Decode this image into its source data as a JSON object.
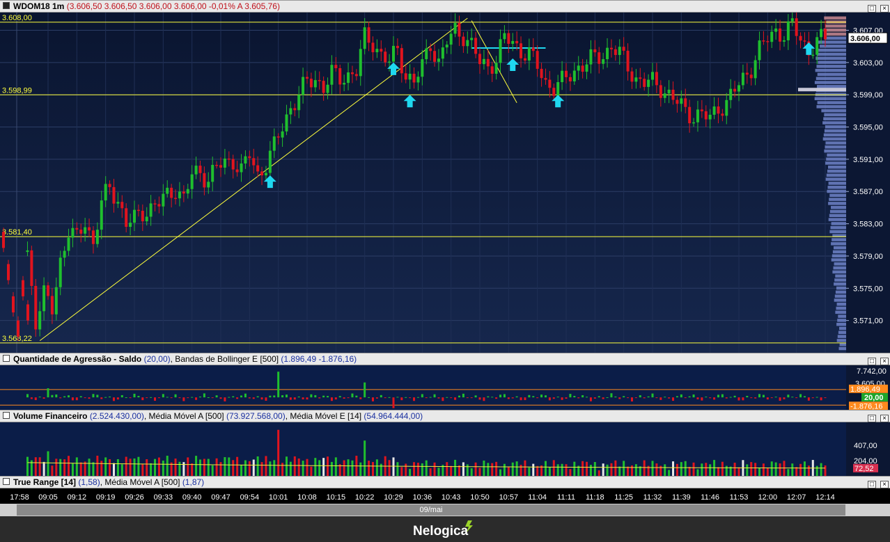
{
  "main": {
    "title": "WDOM18 1m",
    "ohlc": "(3.606,50  3.606,50  3.606,00  3.606,00  -0,01%  A 3.605,76)",
    "last_price_label": "3.606,00",
    "level_labels": [
      "3.608,00",
      "3.598,99",
      "3.581,40",
      "3.568,22"
    ],
    "colors": {
      "up": "#1fbf2e",
      "down": "#e0141e",
      "level": "#ffff3c",
      "arrow": "#1fd8f0",
      "profile": "#6f82c8",
      "profile_top": "#c98890"
    }
  },
  "agr": {
    "title": "Quantidade de Agressão - Saldo",
    "value": "(20,00)",
    "bb_label": ", Bandas de Bollinger E [500]",
    "bb_values": "(1.896,49  -1.876,16)",
    "axis": {
      "top": "7.742,00",
      "mid": "3.605,00",
      "upper": "1.896,49",
      "current": "20,00",
      "lower": "-1.876,16"
    }
  },
  "vol": {
    "title": "Volume Financeiro",
    "value": "(2.524.430,00)",
    "ma_a_label": ", Média Móvel A [500]",
    "ma_a_value": "(73.927.568,00)",
    "ma_e_label": ", Média Móvel E [14]",
    "ma_e_value": "(54.964.444,00)",
    "axis": {
      "top": "407,00",
      "mid": "204,00",
      "current": "72,52"
    }
  },
  "tr": {
    "title": "True Range [14]",
    "value": "(1,58)",
    "ma_label": ", Média Móvel A [500]",
    "ma_value": "(1,87)"
  },
  "date_label": "09/mai",
  "brand": "Nelogica",
  "chart_data": {
    "type": "candlestick",
    "title": "WDOM18 1m",
    "x_ticks": [
      "17:58",
      "09:05",
      "09:12",
      "09:19",
      "09:26",
      "09:33",
      "09:40",
      "09:47",
      "09:54",
      "10:01",
      "10:08",
      "10:15",
      "10:22",
      "10:29",
      "10:36",
      "10:43",
      "10:50",
      "10:57",
      "11:04",
      "11:11",
      "11:18",
      "11:25",
      "11:32",
      "11:39",
      "11:46",
      "11:53",
      "12:00",
      "12:07",
      "12:14"
    ],
    "y_ticks": [
      "3.607,00",
      "3.603,00",
      "3.599,00",
      "3.595,00",
      "3.591,00",
      "3.587,00",
      "3.583,00",
      "3.579,00",
      "3.575,00",
      "3.571,00"
    ],
    "y_tick_values": [
      3607,
      3603,
      3599,
      3595,
      3591,
      3587,
      3583,
      3579,
      3575,
      3571
    ],
    "ylim": [
      3567.0,
      3609.2
    ],
    "horizontal_levels": [
      3608.0,
      3598.99,
      3581.4,
      3568.22
    ],
    "close_path": [
      {
        "t": "09:00",
        "close": 3579.5
      },
      {
        "t": "09:02",
        "close": 3571.0
      },
      {
        "t": "09:04",
        "close": 3574.0
      },
      {
        "t": "09:06",
        "close": 3572.5
      },
      {
        "t": "09:08",
        "close": 3578.5
      },
      {
        "t": "09:10",
        "close": 3582.0
      },
      {
        "t": "09:12",
        "close": 3581.0
      },
      {
        "t": "09:14",
        "close": 3583.5
      },
      {
        "t": "09:16",
        "close": 3580.5
      },
      {
        "t": "09:18",
        "close": 3585.5
      },
      {
        "t": "09:20",
        "close": 3587.5
      },
      {
        "t": "09:22",
        "close": 3586.0
      },
      {
        "t": "09:24",
        "close": 3583.0
      },
      {
        "t": "09:26",
        "close": 3583.5
      },
      {
        "t": "09:28",
        "close": 3584.5
      },
      {
        "t": "09:30",
        "close": 3585.0
      },
      {
        "t": "09:32",
        "close": 3585.5
      },
      {
        "t": "09:34",
        "close": 3586.5
      },
      {
        "t": "09:36",
        "close": 3587.5
      },
      {
        "t": "09:38",
        "close": 3586.0
      },
      {
        "t": "09:40",
        "close": 3589.0
      },
      {
        "t": "09:42",
        "close": 3589.5
      },
      {
        "t": "09:44",
        "close": 3588.5
      },
      {
        "t": "09:46",
        "close": 3590.0
      },
      {
        "t": "09:48",
        "close": 3590.5
      },
      {
        "t": "09:50",
        "close": 3591.0
      },
      {
        "t": "09:52",
        "close": 3589.5
      },
      {
        "t": "09:54",
        "close": 3591.5
      },
      {
        "t": "09:56",
        "close": 3589.0
      },
      {
        "t": "09:58",
        "close": 3590.5
      },
      {
        "t": "10:00",
        "close": 3592.5
      },
      {
        "t": "10:02",
        "close": 3595.0
      },
      {
        "t": "10:04",
        "close": 3597.5
      },
      {
        "t": "10:06",
        "close": 3599.0
      },
      {
        "t": "10:08",
        "close": 3600.5
      },
      {
        "t": "10:10",
        "close": 3601.0
      },
      {
        "t": "10:12",
        "close": 3600.0
      },
      {
        "t": "10:14",
        "close": 3601.5
      },
      {
        "t": "10:16",
        "close": 3601.0
      },
      {
        "t": "10:18",
        "close": 3601.5
      },
      {
        "t": "10:20",
        "close": 3602.0
      },
      {
        "t": "10:22",
        "close": 3606.0
      },
      {
        "t": "10:24",
        "close": 3605.5
      },
      {
        "t": "10:26",
        "close": 3604.0
      },
      {
        "t": "10:28",
        "close": 3603.0
      },
      {
        "t": "10:30",
        "close": 3604.5
      },
      {
        "t": "10:32",
        "close": 3601.5
      },
      {
        "t": "10:34",
        "close": 3600.5
      },
      {
        "t": "10:36",
        "close": 3602.5
      },
      {
        "t": "10:38",
        "close": 3605.5
      },
      {
        "t": "10:40",
        "close": 3603.0
      },
      {
        "t": "10:42",
        "close": 3605.5
      },
      {
        "t": "10:44",
        "close": 3607.0
      },
      {
        "t": "10:46",
        "close": 3606.5
      },
      {
        "t": "10:48",
        "close": 3605.0
      },
      {
        "t": "10:50",
        "close": 3603.0
      },
      {
        "t": "10:52",
        "close": 3602.5
      },
      {
        "t": "10:54",
        "close": 3603.5
      },
      {
        "t": "10:56",
        "close": 3606.0
      },
      {
        "t": "10:58",
        "close": 3605.5
      },
      {
        "t": "11:00",
        "close": 3604.5
      },
      {
        "t": "11:02",
        "close": 3604.0
      },
      {
        "t": "11:04",
        "close": 3602.5
      },
      {
        "t": "11:06",
        "close": 3600.5
      },
      {
        "t": "11:08",
        "close": 3600.0
      },
      {
        "t": "11:10",
        "close": 3600.5
      },
      {
        "t": "11:12",
        "close": 3601.5
      },
      {
        "t": "11:14",
        "close": 3602.5
      },
      {
        "t": "11:16",
        "close": 3603.0
      },
      {
        "t": "11:18",
        "close": 3603.5
      },
      {
        "t": "11:20",
        "close": 3604.0
      },
      {
        "t": "11:22",
        "close": 3605.0
      },
      {
        "t": "11:24",
        "close": 3604.0
      },
      {
        "t": "11:26",
        "close": 3602.5
      },
      {
        "t": "11:28",
        "close": 3601.0
      },
      {
        "t": "11:30",
        "close": 3600.5
      },
      {
        "t": "11:32",
        "close": 3600.5
      },
      {
        "t": "11:34",
        "close": 3600.0
      },
      {
        "t": "11:36",
        "close": 3599.0
      },
      {
        "t": "11:38",
        "close": 3598.0
      },
      {
        "t": "11:40",
        "close": 3597.0
      },
      {
        "t": "11:42",
        "close": 3596.5
      },
      {
        "t": "11:44",
        "close": 3596.5
      },
      {
        "t": "11:46",
        "close": 3596.0
      },
      {
        "t": "11:48",
        "close": 3597.5
      },
      {
        "t": "11:50",
        "close": 3598.0
      },
      {
        "t": "11:52",
        "close": 3599.5
      },
      {
        "t": "11:54",
        "close": 3601.0
      },
      {
        "t": "11:56",
        "close": 3602.5
      },
      {
        "t": "11:58",
        "close": 3604.5
      },
      {
        "t": "12:00",
        "close": 3606.0
      },
      {
        "t": "12:02",
        "close": 3607.0
      },
      {
        "t": "12:04",
        "close": 3606.5
      },
      {
        "t": "12:06",
        "close": 3607.5
      },
      {
        "t": "12:08",
        "close": 3606.0
      },
      {
        "t": "12:10",
        "close": 3604.5
      },
      {
        "t": "12:12",
        "close": 3605.5
      },
      {
        "t": "12:14",
        "close": 3606.0
      }
    ],
    "signal_arrows": [
      {
        "t": "09:59",
        "price": 3589.0
      },
      {
        "t": "10:29",
        "price": 3603.0
      },
      {
        "t": "10:33",
        "price": 3599.0
      },
      {
        "t": "10:58",
        "price": 3603.5
      },
      {
        "t": "11:09",
        "price": 3599.0
      },
      {
        "t": "12:10",
        "price": 3605.5
      }
    ],
    "trendlines": [
      {
        "from": {
          "t": "09:03",
          "price": 3568.5
        },
        "to": {
          "t": "10:47",
          "price": 3608.5
        }
      },
      {
        "from": {
          "t": "10:48",
          "price": 3608.2
        },
        "to": {
          "t": "10:59",
          "price": 3598.0
        }
      }
    ],
    "resistance_segment": {
      "from": "10:48",
      "to": "11:06",
      "price": 3604.8
    },
    "agr_series": {
      "name": "Quantidade de Agressão - Saldo",
      "last": 20.0,
      "upper_band": 1896.49,
      "lower_band": -1876.16,
      "ylim": [
        -3000,
        7742
      ]
    },
    "volume_series": {
      "name": "Volume Financeiro",
      "last": 72.52,
      "ylim": [
        0,
        500
      ]
    }
  }
}
